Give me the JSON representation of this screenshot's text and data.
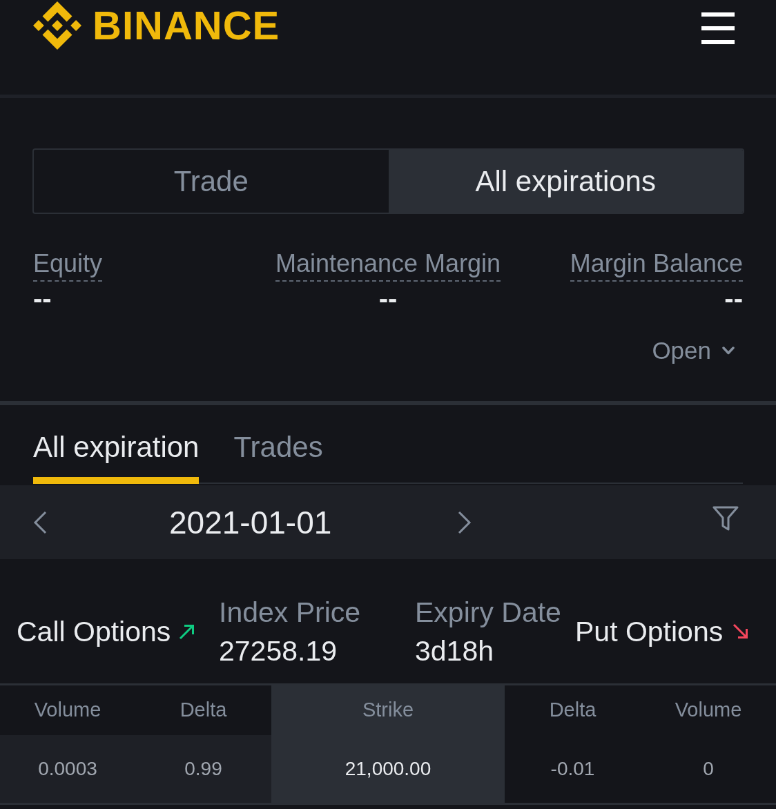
{
  "header": {
    "logo_text": "BINANCE"
  },
  "mode_toggle": [
    {
      "label": "Trade",
      "selected": false
    },
    {
      "label": "All expirations",
      "selected": true
    }
  ],
  "account_metrics": [
    {
      "label": "Equity",
      "value": "--"
    },
    {
      "label": "Maintenance Margin",
      "value": "--"
    },
    {
      "label": "Margin Balance",
      "value": "--"
    }
  ],
  "position_filter": {
    "label": "Open"
  },
  "tabs": [
    {
      "label": "All expiration",
      "selected": true
    },
    {
      "label": "Trades",
      "selected": false
    }
  ],
  "date_nav": {
    "date": "2021-01-01"
  },
  "summary": {
    "call_label": "Call Options",
    "stats": [
      {
        "label": "Index Price",
        "value": "27258.19"
      },
      {
        "label": "Expiry Date",
        "value": "3d18h"
      }
    ],
    "put_label": "Put Options"
  },
  "table": {
    "columns": [
      {
        "label": "Volume",
        "kind": "call"
      },
      {
        "label": "Delta",
        "kind": "call"
      },
      {
        "label": "Strike",
        "kind": "strike"
      },
      {
        "label": "Delta",
        "kind": "put"
      },
      {
        "label": "Volume",
        "kind": "put"
      }
    ],
    "rows": [
      {
        "cells": [
          "0.0003",
          "0.99",
          "21,000.00",
          "-0.01",
          "0"
        ],
        "call_itm": true,
        "put_itm": false
      }
    ]
  }
}
